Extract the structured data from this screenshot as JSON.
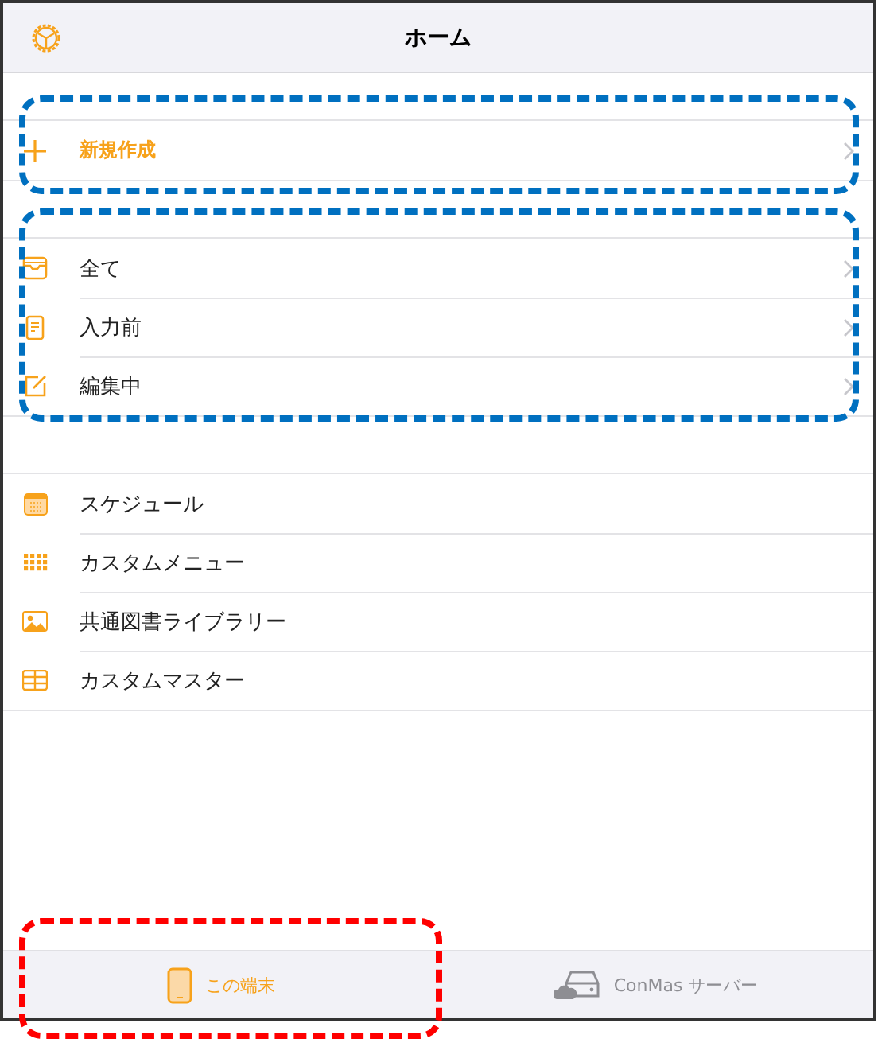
{
  "header": {
    "title": "ホーム"
  },
  "sections": [
    {
      "disclosure": true,
      "items": [
        {
          "label": "新規作成",
          "accent": true
        }
      ]
    },
    {
      "disclosure": true,
      "items": [
        {
          "label": "全て",
          "accent": false
        },
        {
          "label": "入力前",
          "accent": false
        },
        {
          "label": "編集中",
          "accent": false
        }
      ]
    },
    {
      "disclosure": false,
      "items": [
        {
          "label": "スケジュール",
          "accent": false
        },
        {
          "label": "カスタムメニュー",
          "accent": false
        },
        {
          "label": "共通図書ライブラリー",
          "accent": false
        },
        {
          "label": "カスタムマスター",
          "accent": false
        }
      ]
    }
  ],
  "tabs": [
    {
      "label": "この端末",
      "selected": true
    },
    {
      "label": "ConMas サーバー",
      "selected": false
    }
  ],
  "annotations": [
    {
      "color": "#0070c0"
    },
    {
      "color": "#0070c0"
    },
    {
      "color": "#ff0000"
    }
  ]
}
